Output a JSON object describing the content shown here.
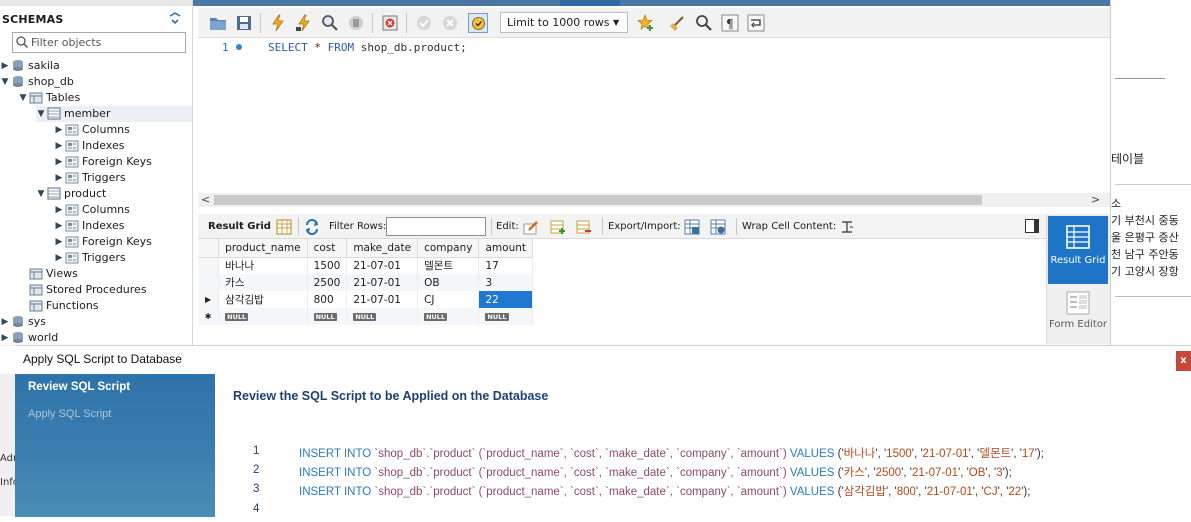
{
  "navigator": {
    "title": "SCHEMAS",
    "filter_placeholder": "Filter objects",
    "tree": [
      {
        "label": "sakila"
      },
      {
        "label": "shop_db"
      },
      {
        "label": "Tables"
      },
      {
        "label": "member"
      },
      {
        "label": "Columns"
      },
      {
        "label": "Indexes"
      },
      {
        "label": "Foreign Keys"
      },
      {
        "label": "Triggers"
      },
      {
        "label": "product"
      },
      {
        "label": "Columns"
      },
      {
        "label": "Indexes"
      },
      {
        "label": "Foreign Keys"
      },
      {
        "label": "Triggers"
      },
      {
        "label": "Views"
      },
      {
        "label": "Stored Procedures"
      },
      {
        "label": "Functions"
      },
      {
        "label": "sys"
      },
      {
        "label": "world"
      }
    ]
  },
  "editor": {
    "limit_label": "Limit to 1000 rows",
    "line_number": "1",
    "sql": {
      "kw1": "SELECT",
      "star": " * ",
      "kw2": "FROM",
      "target": " shop_db.product;"
    }
  },
  "result_toolbar": {
    "result_grid": "Result Grid",
    "filter_rows": "Filter Rows:",
    "edit": "Edit:",
    "export_import": "Export/Import:",
    "wrap_cell": "Wrap Cell Content:"
  },
  "grid": {
    "columns": [
      "product_name",
      "cost",
      "make_date",
      "company",
      "amount"
    ],
    "rows": [
      [
        "바나나",
        "1500",
        "21-07-01",
        "델몬트",
        "17"
      ],
      [
        "카스",
        "2500",
        "21-07-01",
        "OB",
        "3"
      ],
      [
        "삼각김밥",
        "800",
        "21-07-01",
        "CJ",
        "22"
      ]
    ],
    "null_label": "NULL"
  },
  "side_panel": {
    "result_grid": "Result Grid",
    "form_editor": "Form Editor"
  },
  "background": {
    "doc_fragments": [
      "테이블",
      "소",
      "기 부천시 중동",
      "울 은평구 증산",
      "천 남구 주안동",
      "기 고양시 장항"
    ],
    "left_fragments": [
      "Adr",
      "Info"
    ]
  },
  "dialog": {
    "title": "Apply SQL Script to Database",
    "close": "x",
    "steps": [
      "Review SQL Script",
      "Apply SQL Script"
    ],
    "heading": "Review the SQL Script to be Applied on the Database",
    "lines": [
      {
        "no": "1",
        "name": "바나나",
        "cost": "1500",
        "date": "21-07-01",
        "company": "델몬트",
        "amount": "17"
      },
      {
        "no": "2",
        "name": "카스",
        "cost": "2500",
        "date": "21-07-01",
        "company": "OB",
        "amount": "3"
      },
      {
        "no": "3",
        "name": "삼각김밥",
        "cost": "800",
        "date": "21-07-01",
        "company": "CJ",
        "amount": "22"
      }
    ],
    "last_line_no": "4",
    "sql_parts": {
      "insert": "INSERT INTO",
      "table": "`shop_db`.`product`",
      "cols": "(`product_name`, `cost`, `make_date`, `company`, `amount`)",
      "values": "VALUES"
    }
  }
}
